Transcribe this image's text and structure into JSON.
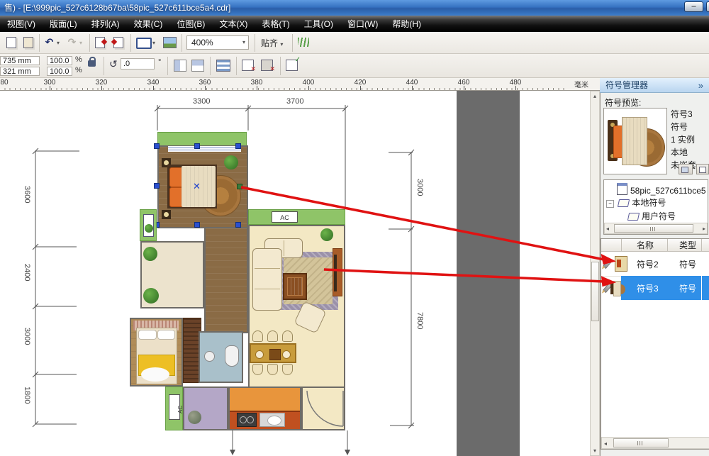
{
  "title_bar": {
    "title": "售) - [E:\\999pic_527c6128b67ba\\58pic_527c611bce5a4.cdr]",
    "minimize_glyph": "–"
  },
  "menu_bar": {
    "items": [
      "视图(V)",
      "版面(L)",
      "排列(A)",
      "效果(C)",
      "位图(B)",
      "文本(X)",
      "表格(T)",
      "工具(O)",
      "窗口(W)",
      "帮助(H)"
    ]
  },
  "toolbar": {
    "undo_glyph": "↶",
    "redo_glyph": "↷",
    "zoom_value": "400%",
    "snap_label": "贴齐"
  },
  "property_bar": {
    "pos_x": "735 mm",
    "pos_y": "321 mm",
    "scale_x": "100.0",
    "scale_y": "100.0",
    "percent_x": "%",
    "percent_y": "%",
    "rotate_glyph": "↺",
    "rotation": ".0",
    "degree": "°"
  },
  "ruler": {
    "h_ticks": [
      "80",
      "300",
      "320",
      "340",
      "360",
      "380",
      "400",
      "420",
      "440",
      "460",
      "480"
    ],
    "unit": "毫米"
  },
  "drawing": {
    "dims_top": [
      "3300",
      "3700"
    ],
    "dims_left": [
      "3600",
      "2400",
      "3000",
      "1800"
    ],
    "dims_right": [
      "3000",
      "7800"
    ],
    "ac_horizontal": "AC",
    "ac_vertical": "AC",
    "selection_x_glyph": "✕"
  },
  "docker": {
    "title": "符号管理器",
    "collapse_glyph": "»",
    "preview_label": "符号预览:",
    "info_lines": [
      "符号3",
      "符号",
      "1 实例",
      "本地",
      "未嵌套"
    ],
    "tree": {
      "root": "58pic_527c611bce5",
      "local": "本地符号",
      "user": "用户符号",
      "expander": "−"
    },
    "list": {
      "col_name": "名称",
      "col_type": "类型",
      "rows": [
        {
          "name": "符号2",
          "type": "符号"
        },
        {
          "name": "符号3",
          "type": "符号"
        }
      ]
    }
  },
  "colors": {
    "selection_blue": "#2f8fe8",
    "arrow_red": "#e01212",
    "balcony_green": "#8fc468",
    "titlebar_blue": "#3672c2",
    "gray_band": "#6b6b6b"
  }
}
